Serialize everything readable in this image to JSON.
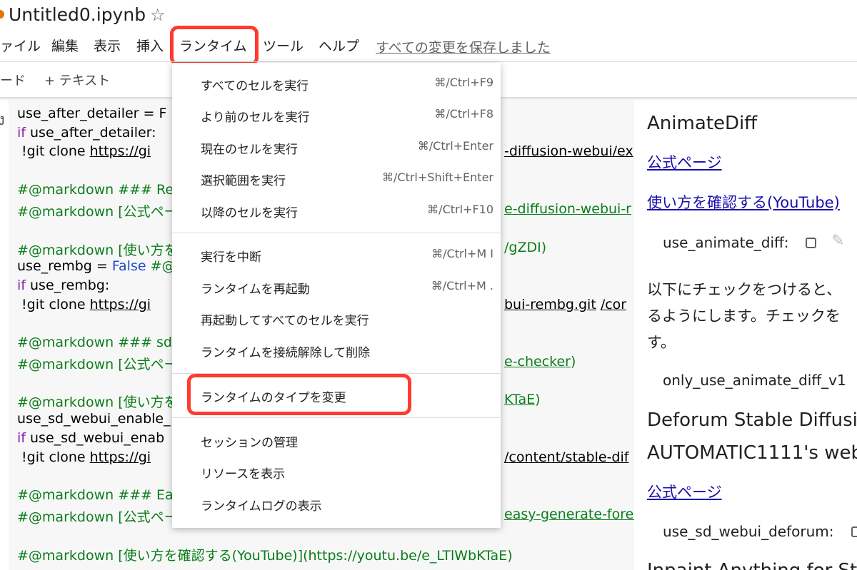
{
  "notebook": {
    "title": "Untitled0.ipynb",
    "star_icon": "star-icon"
  },
  "menubar": {
    "items": [
      "ァイル",
      "編集",
      "表示",
      "挿入",
      "ランタイム",
      "ツール",
      "ヘルプ"
    ],
    "saved_status": "すべての変更を保存しました"
  },
  "toolbar": {
    "code_label": "ード",
    "text_label": "+ テキスト"
  },
  "runtime_menu": {
    "groups": [
      [
        {
          "label": "すべてのセルを実行",
          "shortcut": "⌘/Ctrl+F9"
        },
        {
          "label": "より前のセルを実行",
          "shortcut": "⌘/Ctrl+F8"
        },
        {
          "label": "現在のセルを実行",
          "shortcut": "⌘/Ctrl+Enter"
        },
        {
          "label": "選択範囲を実行",
          "shortcut": "⌘/Ctrl+Shift+Enter"
        },
        {
          "label": "以降のセルを実行",
          "shortcut": "⌘/Ctrl+F10"
        }
      ],
      [
        {
          "label": "実行を中断",
          "shortcut": "⌘/Ctrl+M I"
        },
        {
          "label": "ランタイムを再起動",
          "shortcut": "⌘/Ctrl+M ."
        },
        {
          "label": "再起動してすべてのセルを実行",
          "shortcut": ""
        },
        {
          "label": "ランタイムを接続解除して削除",
          "shortcut": ""
        }
      ],
      [
        {
          "label": "ランタイムのタイプを変更",
          "shortcut": ""
        }
      ],
      [
        {
          "label": "セッションの管理",
          "shortcut": ""
        },
        {
          "label": "リソースを表示",
          "shortcut": ""
        },
        {
          "label": "ランタイムログの表示",
          "shortcut": ""
        }
      ]
    ]
  },
  "code": {
    "lines": [
      {
        "left": "use_after_detailer = F",
        "right": ""
      },
      {
        "left": "if use_after_detailer:",
        "right": ""
      },
      {
        "left": "  !git clone https://gi",
        "right": "-diffusion-webui/ex"
      },
      {
        "left": "#@markdown ### Rer",
        "right": ""
      },
      {
        "left": "#@markdown [公式ペー",
        "right": "e-diffusion-webui-r"
      },
      {
        "left": "#@markdown [使い方を",
        "right": "/gZDI)"
      },
      {
        "left": "use_rembg = False #@",
        "right": ""
      },
      {
        "left": "if use_rembg:",
        "right": ""
      },
      {
        "left": "  !git clone https://gi",
        "right": "bui-rembg.git /cor"
      },
      {
        "left": "#@markdown ### sd-",
        "right": ""
      },
      {
        "left": "#@markdown [公式ペー",
        "right": "e-checker)"
      },
      {
        "left": "#@markdown [使い方を",
        "right": "KTaE)"
      },
      {
        "left": "use_sd_webui_enable_",
        "right": ""
      },
      {
        "left": "if use_sd_webui_enab",
        "right": ""
      },
      {
        "left": "  !git clone https://gi",
        "right": "/content/stable-dif"
      },
      {
        "left": "#@markdown ### Eas",
        "right": ""
      },
      {
        "left": "#@markdown [公式ペー",
        "right": "easy-generate-forev"
      },
      {
        "left": "#@markdown [使い方を確認する(YouTube)](https://youtu.be/e_LTlWbKTaE)",
        "right": ""
      }
    ]
  },
  "form": {
    "h1": "AnimateDiff",
    "link1": "公式ページ",
    "link2": "使い方を確認する(YouTube)",
    "param1": "use_animate_diff:",
    "body1": "以下にチェックをつけると、",
    "body2": "るようにします。チェックを",
    "body3": "す。",
    "param2": "only_use_animate_diff_v1",
    "h2a": "Deforum Stable Diffusio",
    "h2b": "AUTOMATIC1111's web",
    "link3": "公式ページ",
    "param3": "use_sd_webui_deforum:",
    "h3": "Inpaint Anything for Sta"
  },
  "colors": {
    "highlight": "#ff3b30",
    "markdown_green": "#0b7d1b",
    "keyword_purple": "#8a1eaa"
  }
}
